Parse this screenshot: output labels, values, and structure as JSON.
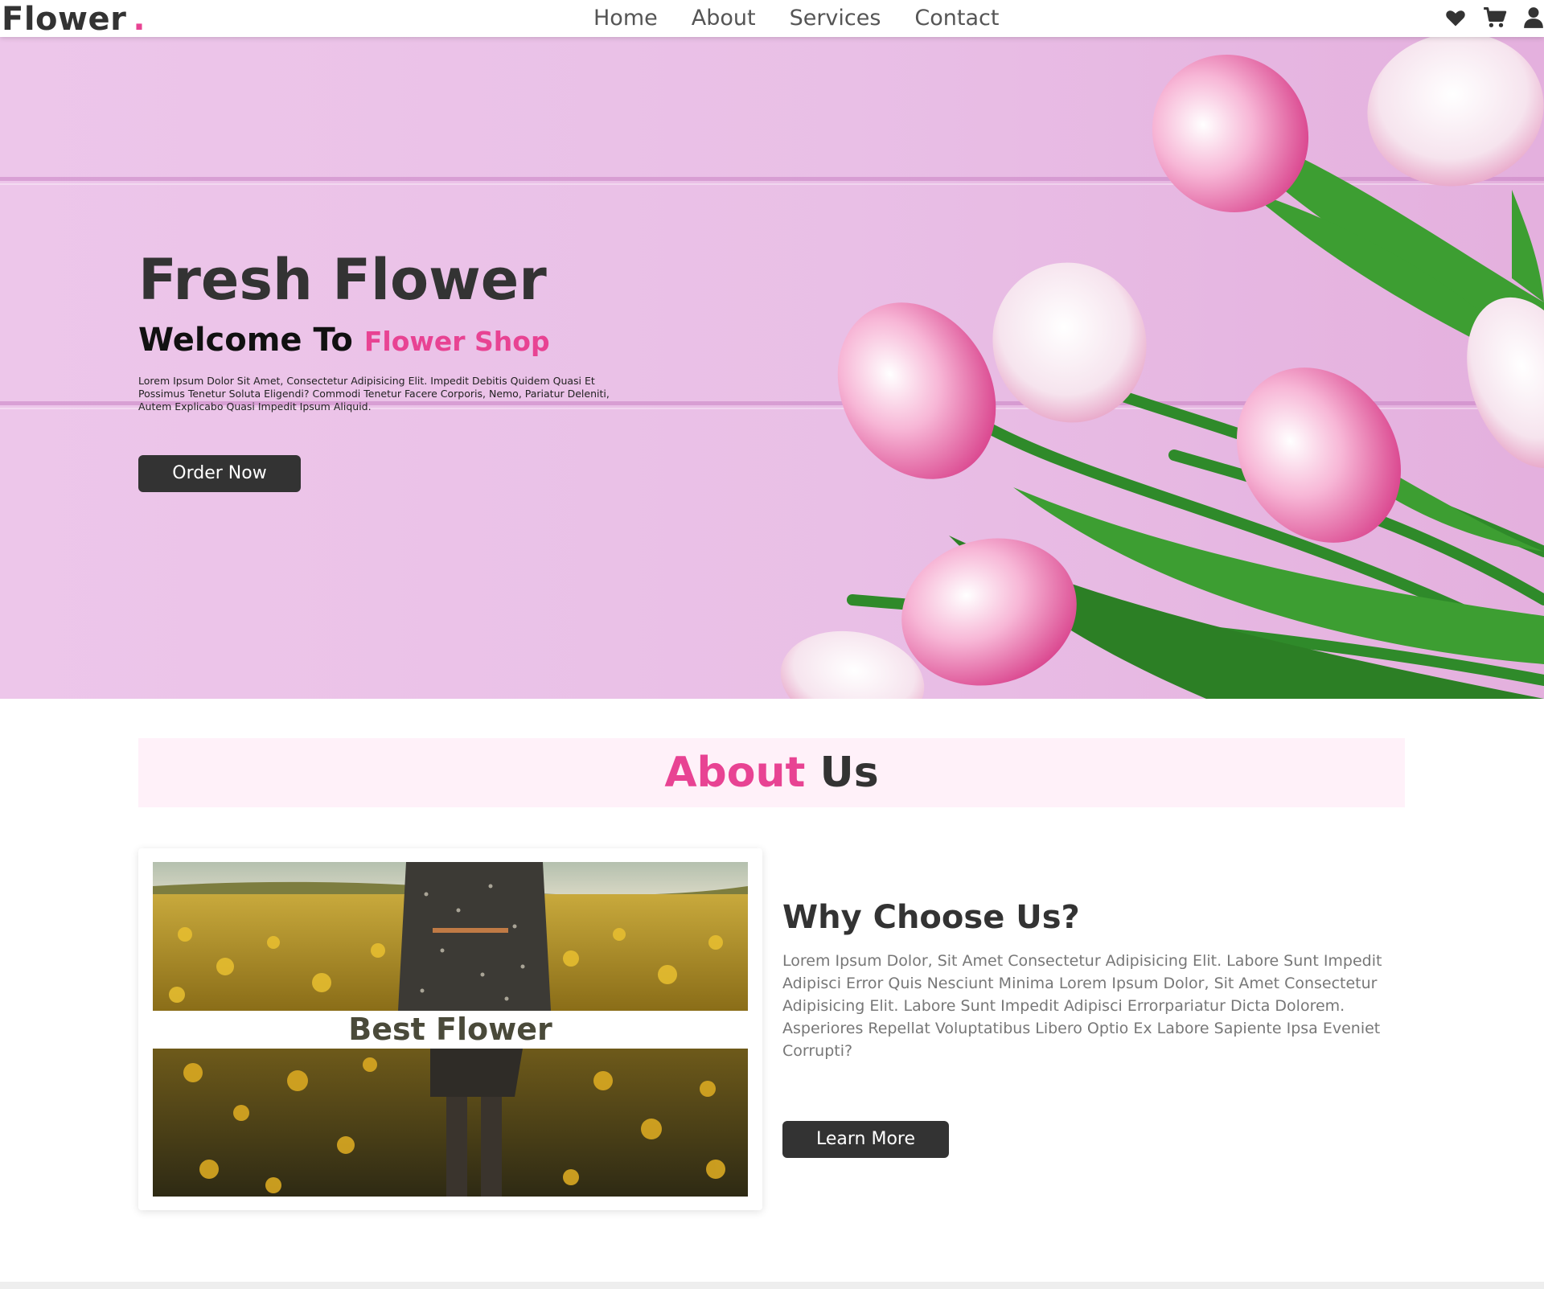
{
  "header": {
    "logo_text": "Flower",
    "logo_dot": ".",
    "nav": [
      "Home",
      "About",
      "Services",
      "Contact"
    ],
    "icons": [
      "heart-icon",
      "cart-icon",
      "user-icon"
    ]
  },
  "hero": {
    "title": "Fresh Flower",
    "welcome": "Welcome To",
    "shop_name": "Flower Shop",
    "text": "Lorem Ipsum Dolor Sit Amet, Consectetur Adipisicing Elit. Impedit Debitis Quidem Quasi Et Possimus Tenetur Soluta Eligendi? Commodi Tenetur Facere Corporis, Nemo, Pariatur Deleniti, Autem Explicabo Quasi Impedit Ipsum Aliquid.",
    "button": "Order Now"
  },
  "about": {
    "heading_accent": "About",
    "heading_rest": "Us",
    "card_caption": "Best Flower",
    "why_title": "Why Choose Us?",
    "why_text": "Lorem Ipsum Dolor, Sit Amet Consectetur Adipisicing Elit. Labore Sunt Impedit Adipisci Error Quis Nesciunt Minima Lorem Ipsum Dolor, Sit Amet Consectetur Adipisicing Elit. Labore Sunt Impedit Adipisci Errorpariatur Dicta Dolorem. Asperiores Repellat Voluptatibus Libero Optio Ex Labore Sapiente Ipsa Eveniet Corrupti?",
    "button": "Learn More"
  },
  "colors": {
    "accent": "#e84393",
    "dark": "#333333",
    "about_bg": "#fff1f9"
  }
}
